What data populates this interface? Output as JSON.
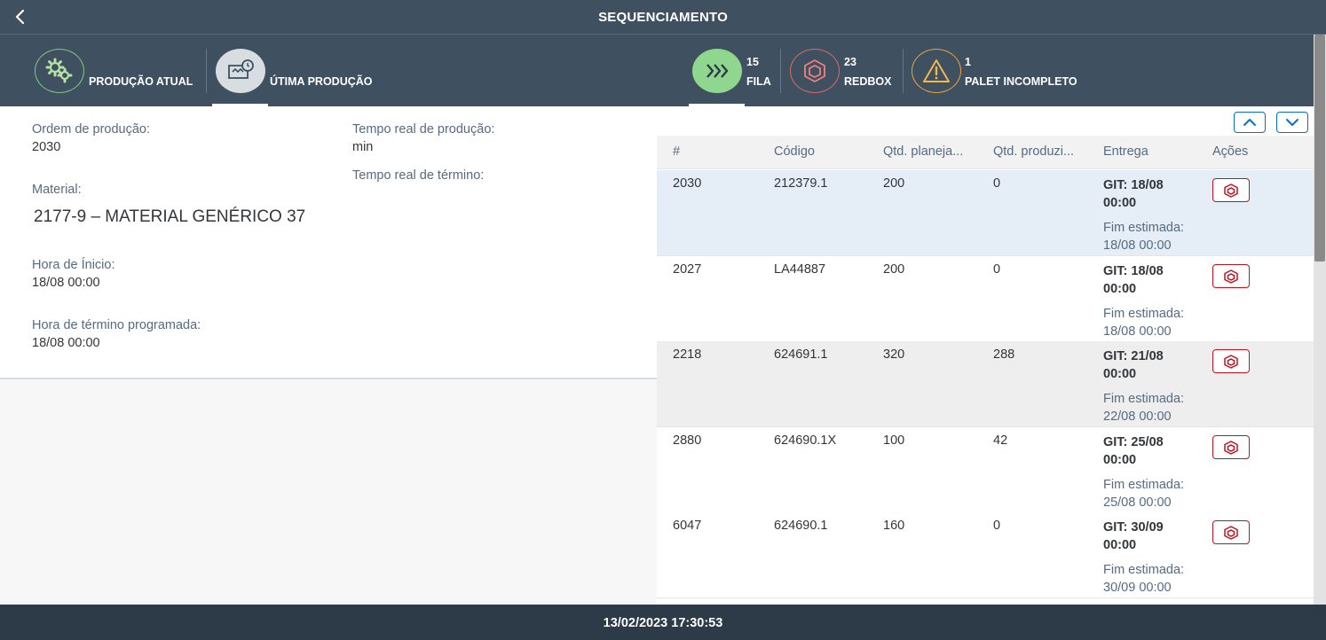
{
  "header": {
    "title": "SEQUENCIAMENTO",
    "back_icon": "chevron-left-icon"
  },
  "tabs": [
    {
      "label": "PRODUÇÃO ATUAL",
      "icon": "gears-icon"
    },
    {
      "label": "ÚTIMA PRODUÇÃO",
      "icon": "history-icon"
    },
    {
      "label": "FILA",
      "count": "15",
      "icon": "fast-forward-icon"
    },
    {
      "label": "REDBOX",
      "count": "23",
      "icon": "box-icon"
    },
    {
      "label": "PALET INCOMPLETO",
      "count": "1",
      "icon": "warning-icon"
    }
  ],
  "details": {
    "ordem_label": "Ordem de produção:",
    "ordem_value": "2030",
    "tempo_real_label": "Tempo real de produção:",
    "tempo_real_value": "min",
    "tempo_termino_label": "Tempo real de término:",
    "material_label": "Material:",
    "material_value": "2177-9 – MATERIAL GENÉRICO 37",
    "inicio_label": "Hora de Ínicio:",
    "inicio_value": "18/08 00:00",
    "termino_label": "Hora de término programada:",
    "termino_value": "18/08 00:00"
  },
  "table": {
    "columns": [
      "#",
      "Código",
      "Qtd. planeja...",
      "Qtd. produzi...",
      "Entrega",
      "Ações"
    ],
    "rows": [
      {
        "num": "2030",
        "codigo": "212379.1",
        "planejado": "200",
        "produzido": "0",
        "git": "GIT: 18/08 00:00",
        "fim_label": "Fim estimada:",
        "fim": "18/08 00:00"
      },
      {
        "num": "2027",
        "codigo": "LA44887",
        "planejado": "200",
        "produzido": "0",
        "git": "GIT: 18/08 00:00",
        "fim_label": "Fim estimada:",
        "fim": "18/08 00:00"
      },
      {
        "num": "2218",
        "codigo": "624691.1",
        "planejado": "320",
        "produzido": "288",
        "git": "GIT: 21/08 00:00",
        "fim_label": "Fim estimada:",
        "fim": "22/08 00:00"
      },
      {
        "num": "2880",
        "codigo": "624690.1X",
        "planejado": "100",
        "produzido": "42",
        "git": "GIT: 25/08 00:00",
        "fim_label": "Fim estimada:",
        "fim": "25/08 00:00"
      },
      {
        "num": "6047",
        "codigo": "624690.1",
        "planejado": "160",
        "produzido": "0",
        "git": "GIT: 30/09 00:00",
        "fim_label": "Fim estimada:",
        "fim": "30/09 00:00"
      }
    ]
  },
  "footer": {
    "timestamp": "13/02/2023 17:30:53"
  },
  "colors": {
    "shell": "#3f5161",
    "footer": "#2d3a47",
    "accent": "#0a6ed1",
    "danger": "#c0131d",
    "fila_green": "#8fd68f"
  }
}
